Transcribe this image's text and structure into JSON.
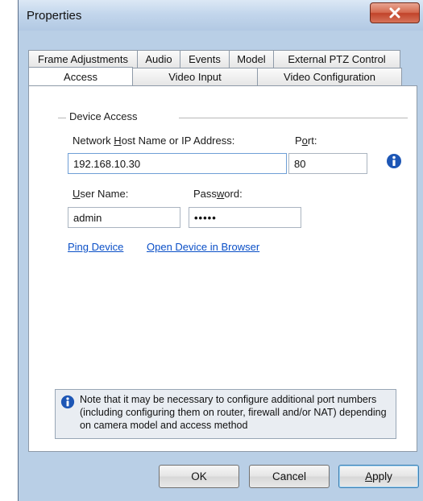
{
  "window": {
    "title": "Properties"
  },
  "tabs": {
    "back_row": [
      {
        "label": "Frame Adjustments"
      },
      {
        "label": "Audio"
      },
      {
        "label": "Events"
      },
      {
        "label": "Model"
      },
      {
        "label": "External PTZ Control"
      }
    ],
    "front_row": [
      {
        "label": "Access",
        "active": true
      },
      {
        "label": "Video Input"
      },
      {
        "label": "Video Configuration"
      }
    ]
  },
  "device_access": {
    "group_label": "Device Access",
    "host_label_pre": "Network ",
    "host_label_key": "H",
    "host_label_post": "ost Name or IP Address:",
    "host_value": "192.168.10.30",
    "port_label_pre": "P",
    "port_label_key": "o",
    "port_label_post": "rt:",
    "port_value": "80",
    "user_label_key": "U",
    "user_label_post": "ser Name:",
    "user_value": "admin",
    "password_label_pre": "Pass",
    "password_label_key": "w",
    "password_label_post": "ord:",
    "password_value": "•••••",
    "ping_link": "Ping Device",
    "open_link": "Open Device in Browser",
    "info_icon": "info-icon"
  },
  "note": {
    "text": "Note that it may be necessary to configure additional port numbers (including configuring them on router, firewall and/or NAT) depending on camera model and access method",
    "icon": "info-icon"
  },
  "buttons": {
    "ok": "OK",
    "cancel": "Cancel",
    "apply_key": "A",
    "apply_post": "pply"
  },
  "colors": {
    "link": "#0a4fc7",
    "info_icon": "#1d56b5",
    "close_button": "#c7492f"
  }
}
